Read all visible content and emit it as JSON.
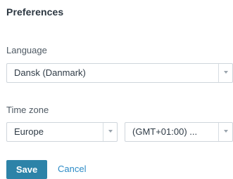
{
  "title": "Preferences",
  "language": {
    "label": "Language",
    "selected": "Dansk (Danmark)"
  },
  "time_zone": {
    "label": "Time zone",
    "region_selected": "Europe",
    "offset_selected": "(GMT+01:00) ..."
  },
  "actions": {
    "save_label": "Save",
    "cancel_label": "Cancel"
  },
  "colors": {
    "save_button_bg": "#2d83a8",
    "cancel_link": "#2c8bc7",
    "select_border": "#cfd5db"
  }
}
